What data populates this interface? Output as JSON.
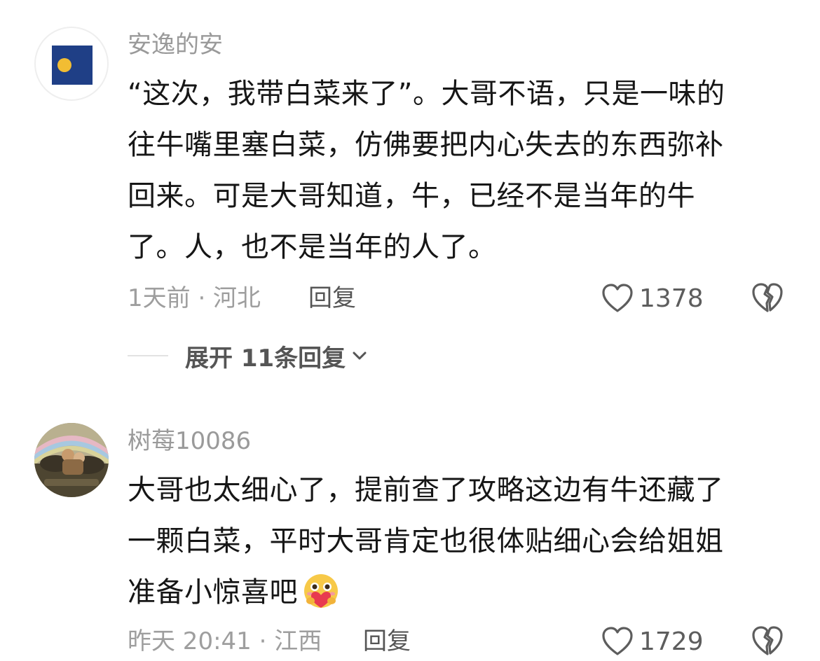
{
  "comments": [
    {
      "username": "安逸的安",
      "text_lines": [
        "“这次，我带白菜来了”。大哥不语，只是一味的",
        "往牛嘴里塞白菜，仿佛要把内心失去的东西弥补",
        "回来。可是大哥知道，牛，已经不是当年的牛",
        "了。人，也不是当年的人了。"
      ],
      "time_location": "1天前 · 河北",
      "reply_label": "回复",
      "like_count": "1378",
      "expand_label": "展开 11条回复"
    },
    {
      "username": "树莓10086",
      "text_lines": [
        "大哥也太细心了，提前查了攻略这边有牛还藏了",
        "一颗白菜，平时大哥肯定也很体贴细心会给姐姐",
        "准备小惊喜吧"
      ],
      "time_location": "昨天 20:41 · 江西",
      "reply_label": "回复",
      "like_count": "1729"
    }
  ],
  "icons": {
    "like": "heart-outline-icon",
    "dislike": "broken-heart-icon",
    "expand": "chevron-down-icon",
    "emoji": "heart-hug-emoji"
  },
  "colors": {
    "text": "#161616",
    "meta": "#9e9e9e",
    "avatar_flag": "#1f3f86",
    "avatar_sun": "#f2bd33"
  }
}
